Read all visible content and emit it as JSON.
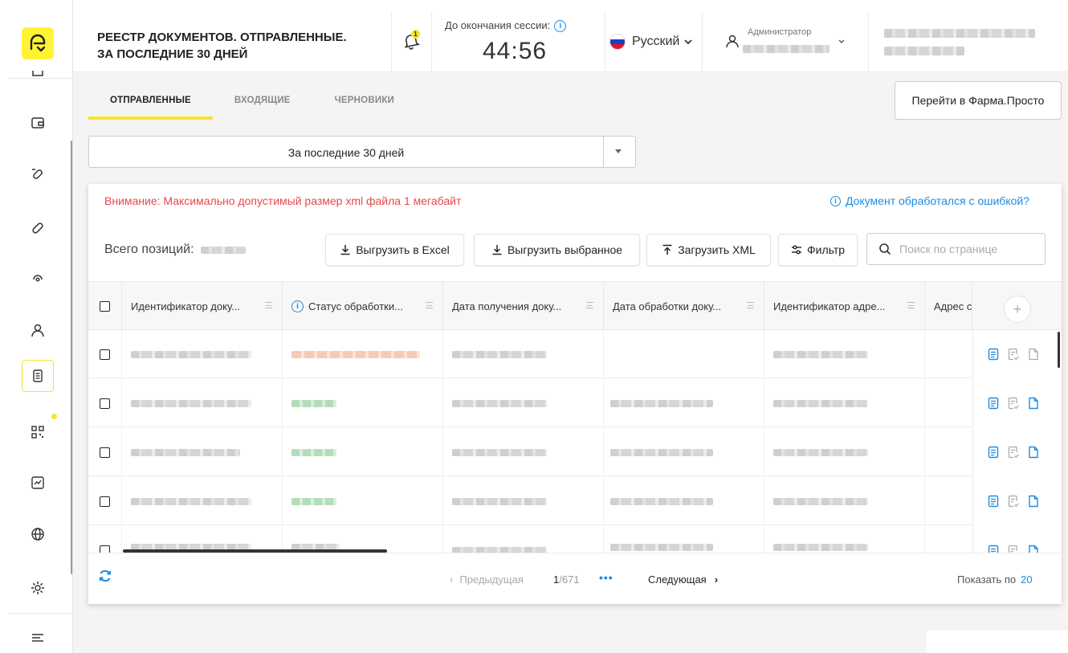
{
  "header": {
    "title_line1": "РЕЕСТР ДОКУМЕНТОВ. ОТПРАВЛЕННЫЕ.",
    "title_line2": "ЗА ПОСЛЕДНИЕ 30 ДНЕЙ",
    "notification_count": "1",
    "session_label": "До окончания сессии:",
    "session_time": "44:56",
    "language": "Русский",
    "user_role": "Администратор"
  },
  "tabs": [
    {
      "label": "ОТПРАВЛЕННЫЕ",
      "active": true
    },
    {
      "label": "ВХОДЯЩИЕ",
      "active": false
    },
    {
      "label": "ЧЕРНОВИКИ",
      "active": false
    }
  ],
  "goto_button": "Перейти в Фарма.Просто",
  "period": {
    "value": "За последние 30 дней"
  },
  "warning": "Внимание: Максимально допустимый размер xml файла 1 мегабайт",
  "help_link": "Документ обработался с ошибкой?",
  "total_label": "Всего позиций:",
  "toolbar": {
    "export_excel": "Выгрузить в Excel",
    "export_selected": "Выгрузить выбранное",
    "upload_xml": "Загрузить XML",
    "filter": "Фильтр",
    "search_placeholder": "Поиск по странице"
  },
  "table": {
    "columns": [
      "Идентификатор доку...",
      "Статус обработки...",
      "Дата получения доку...",
      "Дата обработки доку...",
      "Идентификатор адре...",
      "Адрес с"
    ]
  },
  "pagination": {
    "prev": "Предыдущая",
    "current": "1",
    "total": "/671",
    "more": "•••",
    "next": "Следующая",
    "page_size_label": "Показать по",
    "page_size": "20"
  },
  "colors": {
    "accent": "#F5E52A",
    "link": "#1E8CE0",
    "warning": "#E5484D"
  }
}
